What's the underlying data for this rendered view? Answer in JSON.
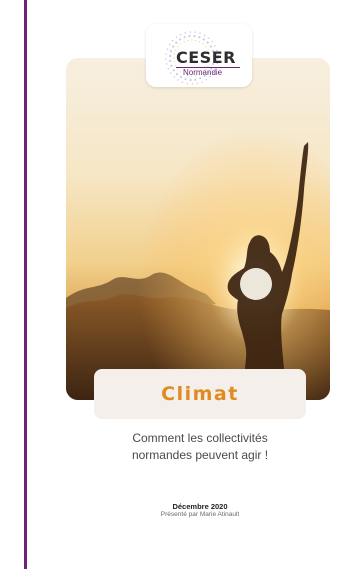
{
  "logo": {
    "name": "CESER",
    "region": "Normandie"
  },
  "cover": {
    "title": "Climat",
    "subtitle_lines": [
      "Comment les collectivités",
      "normandes peuvent agir !"
    ],
    "date": "Décembre 2020",
    "presenter": "Présenté par Marie Atinault"
  },
  "colors": {
    "accent_purple": "#6d2377",
    "title_orange": "#e08a1f",
    "panel_bg": "#f4efeb"
  },
  "image": {
    "description_icon": "sunset-woman-photo"
  }
}
